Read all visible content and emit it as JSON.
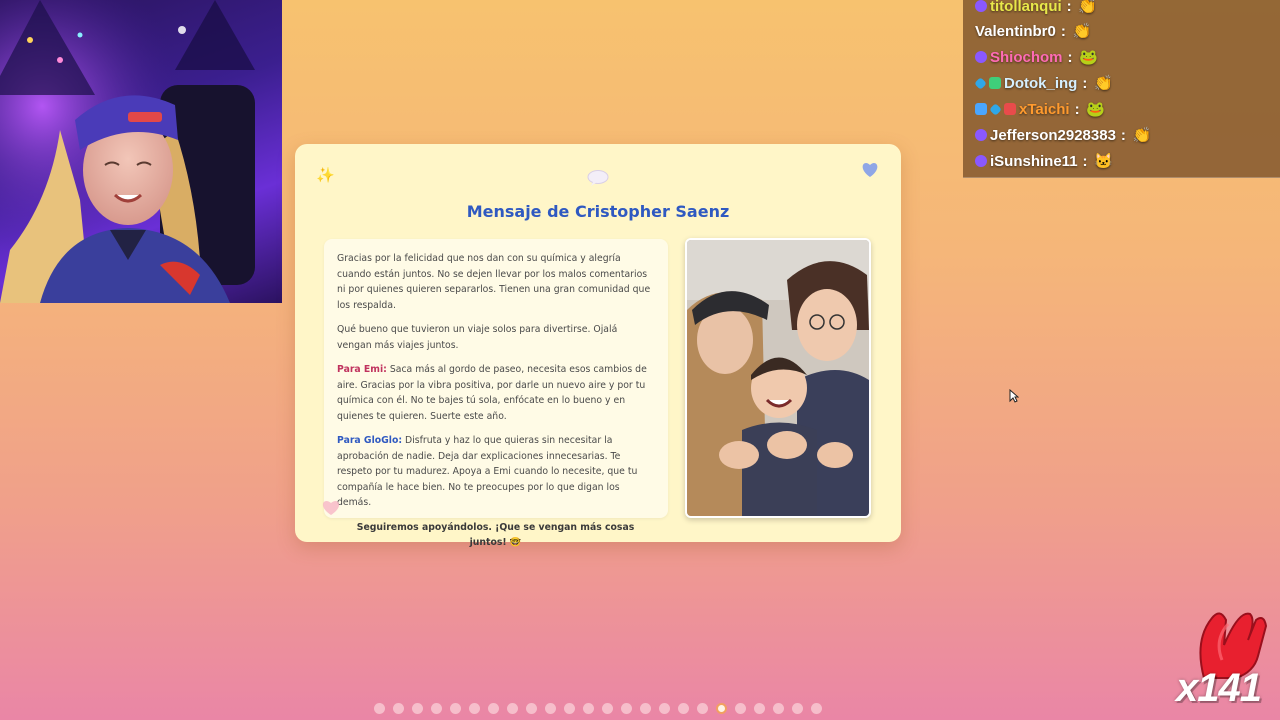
{
  "chat": {
    "messages": [
      {
        "user": "titollanqui",
        "color": "#e8e84a",
        "badges": [
          "purple"
        ],
        "emote": "clap-icon"
      },
      {
        "user": "Valentinbr0",
        "color": "#ffffff",
        "badges": [],
        "emote": "clap-icon"
      },
      {
        "user": "Shiochom",
        "color": "#ff6bb5",
        "badges": [
          "purple"
        ],
        "emote": "frog-icon"
      },
      {
        "user": "Dotok_ing",
        "color": "#d6f0ff",
        "badges": [
          "blue",
          "green"
        ],
        "emote": "clap-icon"
      },
      {
        "user": "xTaichi",
        "color": "#ff9a2e",
        "badges": [
          "ltblue",
          "blue",
          "red"
        ],
        "emote": "frog-icon"
      },
      {
        "user": "Jefferson2928383",
        "color": "#ffffff",
        "badges": [
          "purple"
        ],
        "emote": "clap-icon"
      },
      {
        "user": "iSunshine11",
        "color": "#ffffff",
        "badges": [
          "purple"
        ],
        "emote": "cat-icon"
      }
    ],
    "separator": ":"
  },
  "card": {
    "title": "Mensaje de Cristopher Saenz",
    "paragraph1": "Gracias por la felicidad que nos dan con su química y alegría cuando están juntos. No se dejen llevar por los malos comentarios ni por quienes quieren separarlos. Tienen una gran comunidad que los respalda.",
    "paragraph2": "Qué bueno que tuvieron un viaje solos para divertirse. Ojalá vengan más viajes juntos.",
    "emi_label": "Para Emi:",
    "emi_text": " Saca más al gordo de paseo, necesita esos cambios de aire. Gracias por la vibra positiva, por darle un nuevo aire y por tu química con él. No te bajes tú sola, enfócate en lo bueno y en quienes te quieren. Suerte este año.",
    "gloglo_label": "Para GloGlo:",
    "gloglo_text": " Disfruta y haz lo que quieras sin necesitar la aprobación de nadie. Deja dar explicaciones innecesarias. Te respeto por tu madurez. Apoya a Emi cuando lo necesite, que tu compañía le hace bien. No te preocupes por lo que digan los demás.",
    "closing": "Seguiremos apoyándolos. ¡Que se vengan más cosas juntos! 🤓",
    "decorations": [
      "sparkle-icon",
      "speech-bubble-icon",
      "blue-heart-icon",
      "pink-heart-icon"
    ]
  },
  "slides": {
    "count": 24,
    "active_index": 18
  },
  "alert": {
    "count_text": "x141",
    "icon": "clap-hands-icon",
    "color": "#e8202f"
  },
  "colors": {
    "title": "#2f59c1",
    "emi": "#c0325e",
    "gloglo": "#2f59c1",
    "card_bg": "#fff6c8"
  }
}
